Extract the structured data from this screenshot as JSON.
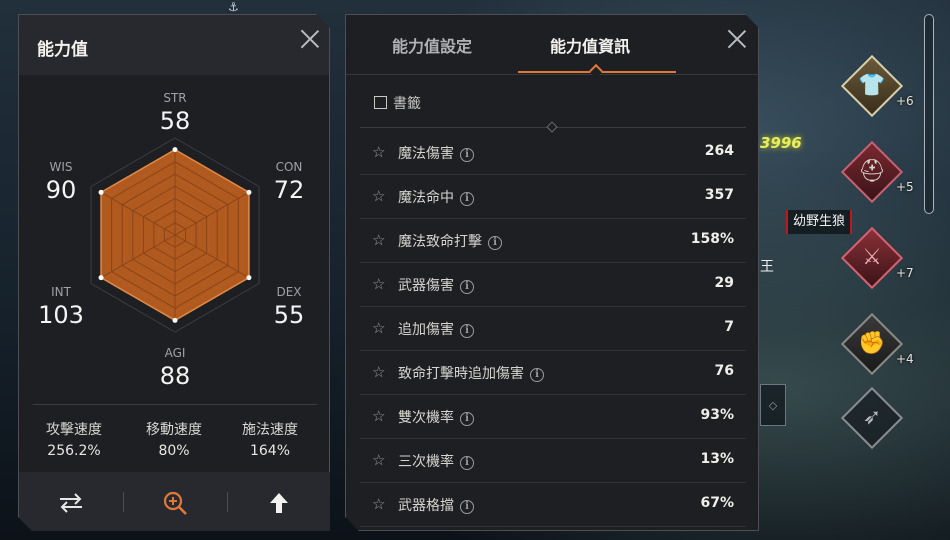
{
  "left_panel": {
    "title": "能力值",
    "stats": [
      {
        "key": "STR",
        "value": "58"
      },
      {
        "key": "CON",
        "value": "72"
      },
      {
        "key": "DEX",
        "value": "55"
      },
      {
        "key": "AGI",
        "value": "88"
      },
      {
        "key": "INT",
        "value": "103"
      },
      {
        "key": "WIS",
        "value": "90"
      }
    ],
    "speeds": [
      {
        "label": "攻擊速度",
        "value": "256.2%"
      },
      {
        "label": "移動速度",
        "value": "80%"
      },
      {
        "label": "施法速度",
        "value": "164%"
      }
    ],
    "footer_icons": [
      "swap-arrows-icon",
      "zoom-in-icon",
      "up-arrow-icon"
    ]
  },
  "right_panel": {
    "tabs": [
      {
        "label": "能力值設定",
        "active": false
      },
      {
        "label": "能力值資訊",
        "active": true
      }
    ],
    "bookmark_label": "書籤",
    "rows": [
      {
        "name": "魔法傷害",
        "value": "264"
      },
      {
        "name": "魔法命中",
        "value": "357"
      },
      {
        "name": "魔法致命打擊",
        "value": "158%"
      },
      {
        "name": "武器傷害",
        "value": "29"
      },
      {
        "name": "追加傷害",
        "value": "7"
      },
      {
        "name": "致命打擊時追加傷害",
        "value": "76"
      },
      {
        "name": "雙次機率",
        "value": "93%"
      },
      {
        "name": "三次機率",
        "value": "13%"
      },
      {
        "name": "武器格擋",
        "value": "67%"
      }
    ]
  },
  "scene": {
    "damage_text": "3996",
    "mob_name": "幼野生狼",
    "king_text": "王",
    "equipment": [
      {
        "icon": "robe-icon",
        "plus": "+6"
      },
      {
        "icon": "helmet-icon",
        "plus": "+5"
      },
      {
        "icon": "sword-icon",
        "plus": "+7"
      },
      {
        "icon": "gauntlet-icon",
        "plus": "+4"
      },
      {
        "icon": "quiver-icon",
        "plus": ""
      }
    ]
  },
  "colors": {
    "accent": "#e0783a",
    "radar_fill": "#c2611f",
    "panel_bg": "#1d1f23"
  }
}
